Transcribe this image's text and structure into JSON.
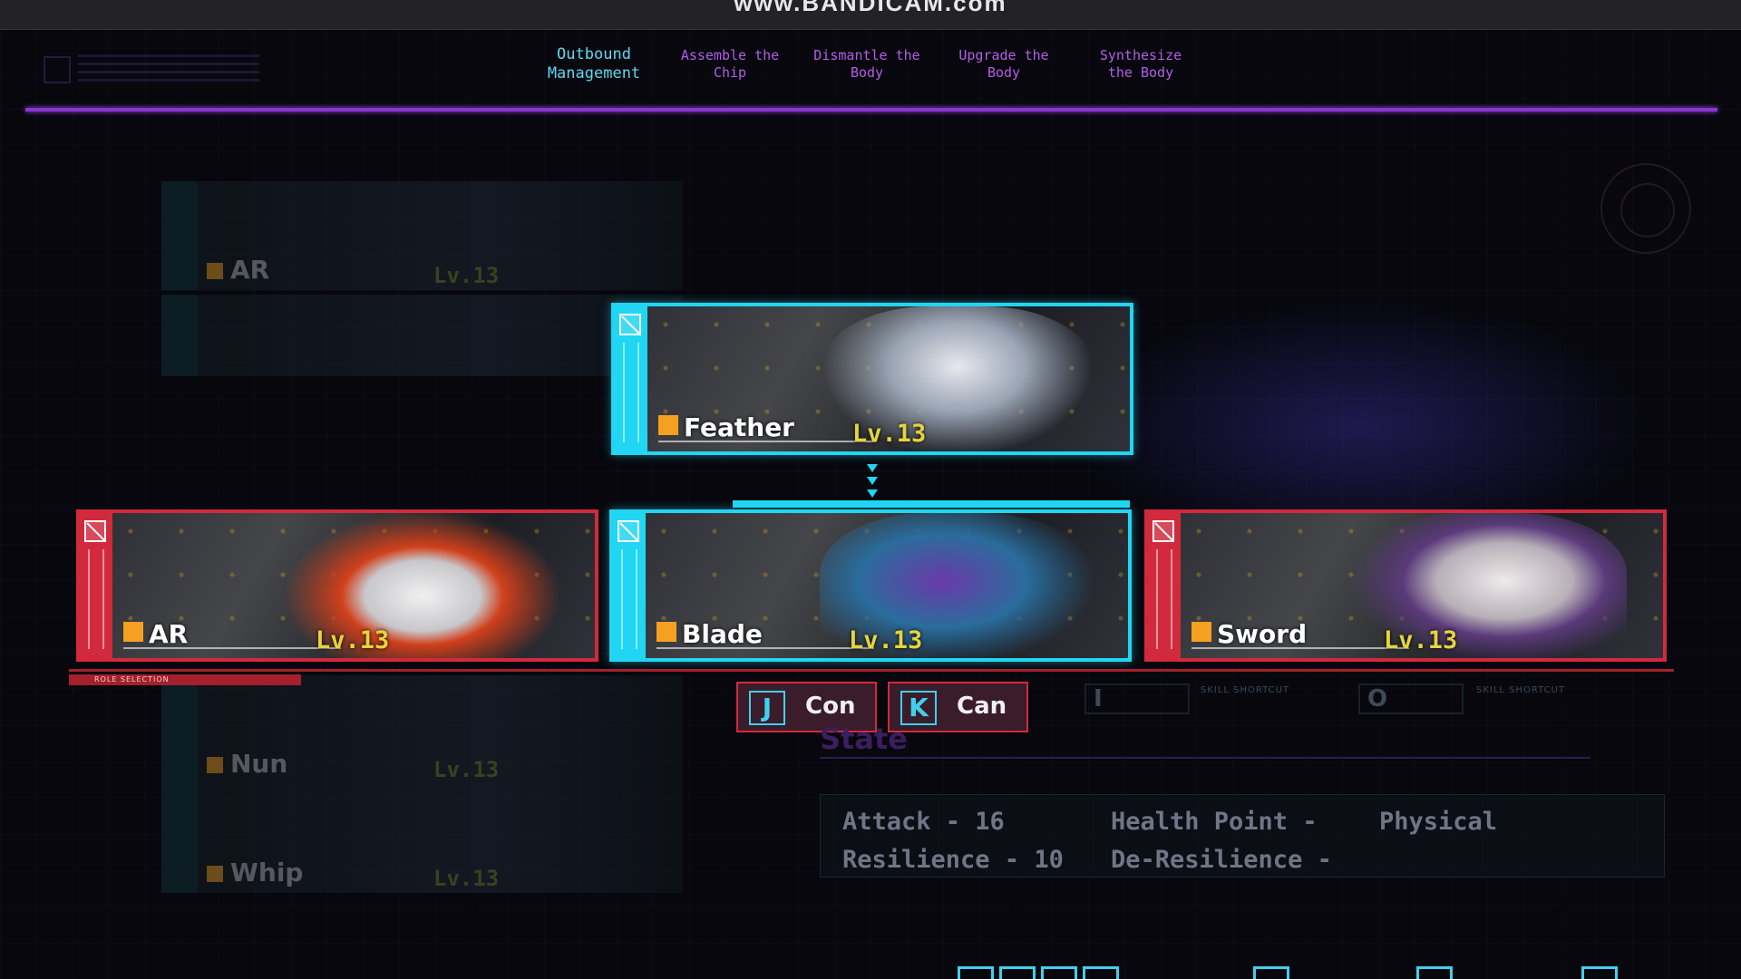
{
  "watermark": "www.BANDICAM.com",
  "nav": {
    "items": [
      {
        "label": "Outbound\nManagement",
        "active": true
      },
      {
        "label": "Assemble the\nChip",
        "active": false
      },
      {
        "label": "Dismantle the\nBody",
        "active": false
      },
      {
        "label": "Upgrade the\nBody",
        "active": false
      },
      {
        "label": "Synthesize\nthe Body",
        "active": false
      }
    ]
  },
  "roster": [
    {
      "name": "AR",
      "level": "Lv.13"
    },
    {
      "name": "Nun",
      "level": "Lv.13"
    },
    {
      "name": "Whip",
      "level": "Lv.13"
    }
  ],
  "selected": {
    "top": {
      "name": "Feather",
      "level": "Lv.13"
    },
    "left": {
      "name": "AR",
      "level": "Lv.13"
    },
    "center": {
      "name": "Blade",
      "level": "Lv.13"
    },
    "right": {
      "name": "Sword",
      "level": "Lv.13"
    }
  },
  "role_selection_label": "ROLE SELECTION",
  "actions": {
    "confirm": {
      "key": "J",
      "label": "Con"
    },
    "cancel": {
      "key": "K",
      "label": "Can"
    }
  },
  "shortcuts": [
    {
      "key": "I",
      "label": "SKILL SHORTCUT"
    },
    {
      "key": "O",
      "label": "SKILL SHORTCUT"
    }
  ],
  "state": {
    "title": "State",
    "attack": "Attack - 16",
    "health": "Health Point -",
    "type": "Physical",
    "resilience": "Resilience - 10",
    "de_resilience": "De-Resilience -"
  },
  "colors": {
    "accent_cyan": "#20d6f2",
    "accent_red": "#d22a3c",
    "accent_purple": "#8a35d4",
    "level_yellow": "#e6d43a"
  },
  "icons": [
    "emblem-icon",
    "arrow-down-icon",
    "radar-icon"
  ]
}
